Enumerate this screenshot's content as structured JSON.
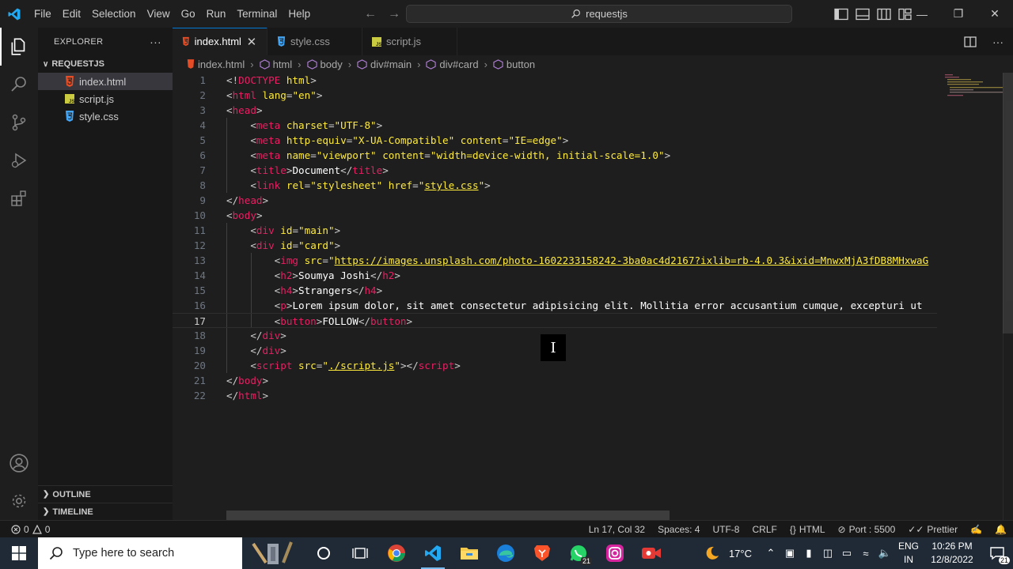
{
  "titlebar": {
    "menu": [
      "File",
      "Edit",
      "Selection",
      "View",
      "Go",
      "Run",
      "Terminal",
      "Help"
    ],
    "search_text": "requestjs"
  },
  "sidebar": {
    "title": "EXPLORER",
    "more": "···",
    "folder": "REQUESTJS",
    "files": [
      {
        "name": "index.html",
        "icon": "html-file-icon",
        "selected": true
      },
      {
        "name": "script.js",
        "icon": "js-file-icon",
        "selected": false
      },
      {
        "name": "style.css",
        "icon": "css-file-icon",
        "selected": false
      }
    ],
    "outline": "OUTLINE",
    "timeline": "TIMELINE"
  },
  "tabs": [
    {
      "label": "index.html",
      "icon": "html-file-icon",
      "active": true
    },
    {
      "label": "style.css",
      "icon": "css-file-icon",
      "active": false
    },
    {
      "label": "script.js",
      "icon": "js-file-icon",
      "active": false
    }
  ],
  "breadcrumb": [
    "index.html",
    "html",
    "body",
    "div#main",
    "div#card",
    "button"
  ],
  "editor": {
    "current_line": 17,
    "lines": [
      {
        "n": "1",
        "tokens": [
          [
            "br",
            "<!"
          ],
          [
            "tag",
            "DOCTYPE"
          ],
          [
            "br",
            " "
          ],
          [
            "attr",
            "html"
          ],
          [
            "br",
            ">"
          ]
        ]
      },
      {
        "n": "2",
        "tokens": [
          [
            "br",
            "<"
          ],
          [
            "tag",
            "html"
          ],
          [
            "br",
            " "
          ],
          [
            "attr",
            "lang"
          ],
          [
            "br",
            "="
          ],
          [
            "str",
            "\"en\""
          ],
          [
            "br",
            ">"
          ]
        ]
      },
      {
        "n": "3",
        "tokens": [
          [
            "br",
            "<"
          ],
          [
            "tag",
            "head"
          ],
          [
            "br",
            ">"
          ]
        ]
      },
      {
        "n": "4",
        "tokens": [
          [
            "br",
            "    <"
          ],
          [
            "tag",
            "meta"
          ],
          [
            "br",
            " "
          ],
          [
            "attr",
            "charset"
          ],
          [
            "br",
            "="
          ],
          [
            "str",
            "\"UTF-8\""
          ],
          [
            "br",
            ">"
          ]
        ]
      },
      {
        "n": "5",
        "tokens": [
          [
            "br",
            "    <"
          ],
          [
            "tag",
            "meta"
          ],
          [
            "br",
            " "
          ],
          [
            "attr",
            "http-equiv"
          ],
          [
            "br",
            "="
          ],
          [
            "str",
            "\"X-UA-Compatible\""
          ],
          [
            "br",
            " "
          ],
          [
            "attr",
            "content"
          ],
          [
            "br",
            "="
          ],
          [
            "str",
            "\"IE=edge\""
          ],
          [
            "br",
            ">"
          ]
        ]
      },
      {
        "n": "6",
        "tokens": [
          [
            "br",
            "    <"
          ],
          [
            "tag",
            "meta"
          ],
          [
            "br",
            " "
          ],
          [
            "attr",
            "name"
          ],
          [
            "br",
            "="
          ],
          [
            "str",
            "\"viewport\""
          ],
          [
            "br",
            " "
          ],
          [
            "attr",
            "content"
          ],
          [
            "br",
            "="
          ],
          [
            "str",
            "\"width=device-width, initial-scale=1.0\""
          ],
          [
            "br",
            ">"
          ]
        ]
      },
      {
        "n": "7",
        "tokens": [
          [
            "br",
            "    <"
          ],
          [
            "tag",
            "title"
          ],
          [
            "br",
            ">"
          ],
          [
            "txt",
            "Document"
          ],
          [
            "br",
            "</"
          ],
          [
            "tag",
            "title"
          ],
          [
            "br",
            ">"
          ]
        ]
      },
      {
        "n": "8",
        "tokens": [
          [
            "br",
            "    <"
          ],
          [
            "tag",
            "link"
          ],
          [
            "br",
            " "
          ],
          [
            "attr",
            "rel"
          ],
          [
            "br",
            "="
          ],
          [
            "str",
            "\"stylesheet\""
          ],
          [
            "br",
            " "
          ],
          [
            "attr",
            "href"
          ],
          [
            "br",
            "="
          ],
          [
            "str",
            "\""
          ],
          [
            "link",
            "style.css"
          ],
          [
            "str",
            "\""
          ],
          [
            "br",
            ">"
          ]
        ]
      },
      {
        "n": "9",
        "tokens": [
          [
            "br",
            "</"
          ],
          [
            "tag",
            "head"
          ],
          [
            "br",
            ">"
          ]
        ]
      },
      {
        "n": "10",
        "tokens": [
          [
            "br",
            "<"
          ],
          [
            "tag",
            "body"
          ],
          [
            "br",
            ">"
          ]
        ]
      },
      {
        "n": "11",
        "tokens": [
          [
            "br",
            "    <"
          ],
          [
            "tag",
            "div"
          ],
          [
            "br",
            " "
          ],
          [
            "attr",
            "id"
          ],
          [
            "br",
            "="
          ],
          [
            "str",
            "\"main\""
          ],
          [
            "br",
            ">"
          ]
        ]
      },
      {
        "n": "12",
        "tokens": [
          [
            "br",
            "    <"
          ],
          [
            "tag",
            "div"
          ],
          [
            "br",
            " "
          ],
          [
            "attr",
            "id"
          ],
          [
            "br",
            "="
          ],
          [
            "str",
            "\"card\""
          ],
          [
            "br",
            ">"
          ]
        ]
      },
      {
        "n": "13",
        "tokens": [
          [
            "br",
            "        <"
          ],
          [
            "tag",
            "img"
          ],
          [
            "br",
            " "
          ],
          [
            "attr",
            "src"
          ],
          [
            "br",
            "="
          ],
          [
            "str",
            "\""
          ],
          [
            "link",
            "https://images.unsplash.com/photo-1602233158242-3ba0ac4d2167?ixlib=rb-4.0.3&ixid=MnwxMjA3fDB8MHxwaG"
          ]
        ]
      },
      {
        "n": "14",
        "tokens": [
          [
            "br",
            "        <"
          ],
          [
            "tag",
            "h2"
          ],
          [
            "br",
            ">"
          ],
          [
            "txt",
            "Soumya Joshi"
          ],
          [
            "br",
            "</"
          ],
          [
            "tag",
            "h2"
          ],
          [
            "br",
            ">"
          ]
        ]
      },
      {
        "n": "15",
        "tokens": [
          [
            "br",
            "        <"
          ],
          [
            "tag",
            "h4"
          ],
          [
            "br",
            ">"
          ],
          [
            "txt",
            "Strangers"
          ],
          [
            "br",
            "</"
          ],
          [
            "tag",
            "h4"
          ],
          [
            "br",
            ">"
          ]
        ]
      },
      {
        "n": "16",
        "tokens": [
          [
            "br",
            "        <"
          ],
          [
            "tag",
            "p"
          ],
          [
            "br",
            ">"
          ],
          [
            "txt",
            "Lorem ipsum dolor, sit amet consectetur adipisicing elit. Mollitia error accusantium cumque, excepturi ut"
          ]
        ]
      },
      {
        "n": "17",
        "tokens": [
          [
            "br",
            "        <"
          ],
          [
            "tag",
            "button"
          ],
          [
            "br",
            ">"
          ],
          [
            "txt",
            "FOLLOW"
          ],
          [
            "br",
            "</"
          ],
          [
            "tag",
            "button"
          ],
          [
            "br",
            ">"
          ]
        ]
      },
      {
        "n": "18",
        "tokens": [
          [
            "br",
            "    </"
          ],
          [
            "tag",
            "div"
          ],
          [
            "br",
            ">"
          ]
        ]
      },
      {
        "n": "19",
        "tokens": [
          [
            "br",
            "    </"
          ],
          [
            "tag",
            "div"
          ],
          [
            "br",
            ">"
          ]
        ]
      },
      {
        "n": "20",
        "tokens": [
          [
            "br",
            "    <"
          ],
          [
            "tag",
            "script"
          ],
          [
            "br",
            " "
          ],
          [
            "attr",
            "src"
          ],
          [
            "br",
            "="
          ],
          [
            "str",
            "\""
          ],
          [
            "link",
            "./script.js"
          ],
          [
            "str",
            "\""
          ],
          [
            "br",
            "></"
          ],
          [
            "tag",
            "script"
          ],
          [
            "br",
            ">"
          ]
        ]
      },
      {
        "n": "21",
        "tokens": [
          [
            "br",
            "</"
          ],
          [
            "tag",
            "body"
          ],
          [
            "br",
            ">"
          ]
        ]
      },
      {
        "n": "22",
        "tokens": [
          [
            "br",
            "</"
          ],
          [
            "tag",
            "html"
          ],
          [
            "br",
            ">"
          ]
        ]
      }
    ]
  },
  "statusbar": {
    "errors": "0",
    "warnings": "0",
    "position": "Ln 17, Col 32",
    "spaces": "Spaces: 4",
    "encoding": "UTF-8",
    "eol": "CRLF",
    "language": "HTML",
    "port": "Port : 5500",
    "prettier": "Prettier"
  },
  "taskbar": {
    "search_placeholder": "Type here to search",
    "whatsapp_badge": "21",
    "weather": "17°C",
    "lang_top": "ENG",
    "lang_bottom": "IN",
    "time": "10:26 PM",
    "date": "12/8/2022",
    "notif_count": "21"
  },
  "colors": {
    "tag": "#e91e63",
    "attr": "#ffeb3b",
    "accent": "#0078d4",
    "vscode_blue": "#23a9f2"
  }
}
